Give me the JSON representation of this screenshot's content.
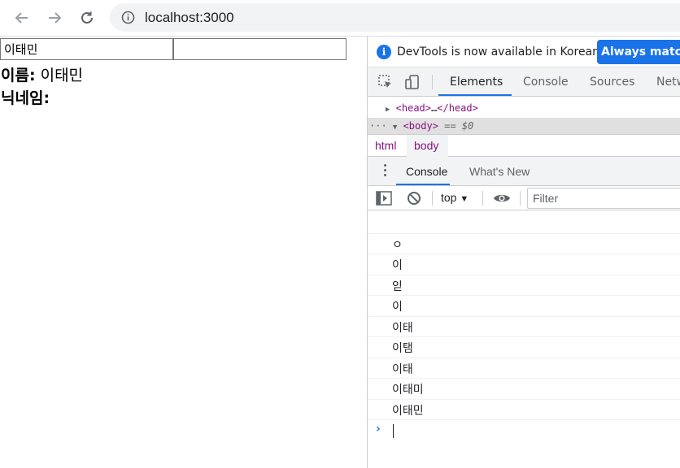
{
  "browser": {
    "url": "localhost:3000"
  },
  "page": {
    "name_input_value": "이태민",
    "nick_input_value": "",
    "name_label": "이름:",
    "name_value": " 이태민",
    "nick_label": "닉네임:",
    "nick_value": ""
  },
  "devtools": {
    "infobar": {
      "message": "DevTools is now available in Korean!",
      "button": "Always match"
    },
    "tabs": [
      "Elements",
      "Console",
      "Sources",
      "Netw"
    ],
    "active_tab": "Elements",
    "dom": {
      "head_open": "<head>",
      "head_ellipsis": "…",
      "head_close": "</head>",
      "body_tag": "<body>",
      "body_suffix": " == $0"
    },
    "breadcrumbs": [
      "html",
      "body"
    ],
    "drawer_tabs": [
      "Console",
      "What's New"
    ],
    "active_drawer_tab": "Console",
    "console": {
      "context": "top",
      "filter_placeholder": "Filter",
      "logs": [
        "ㅇ",
        "이",
        "읻",
        "이",
        "이태",
        "이탬",
        "이태",
        "이태미",
        "이태민"
      ]
    }
  },
  "colors": {
    "accent": "#1a73e8",
    "tag": "#881280"
  }
}
